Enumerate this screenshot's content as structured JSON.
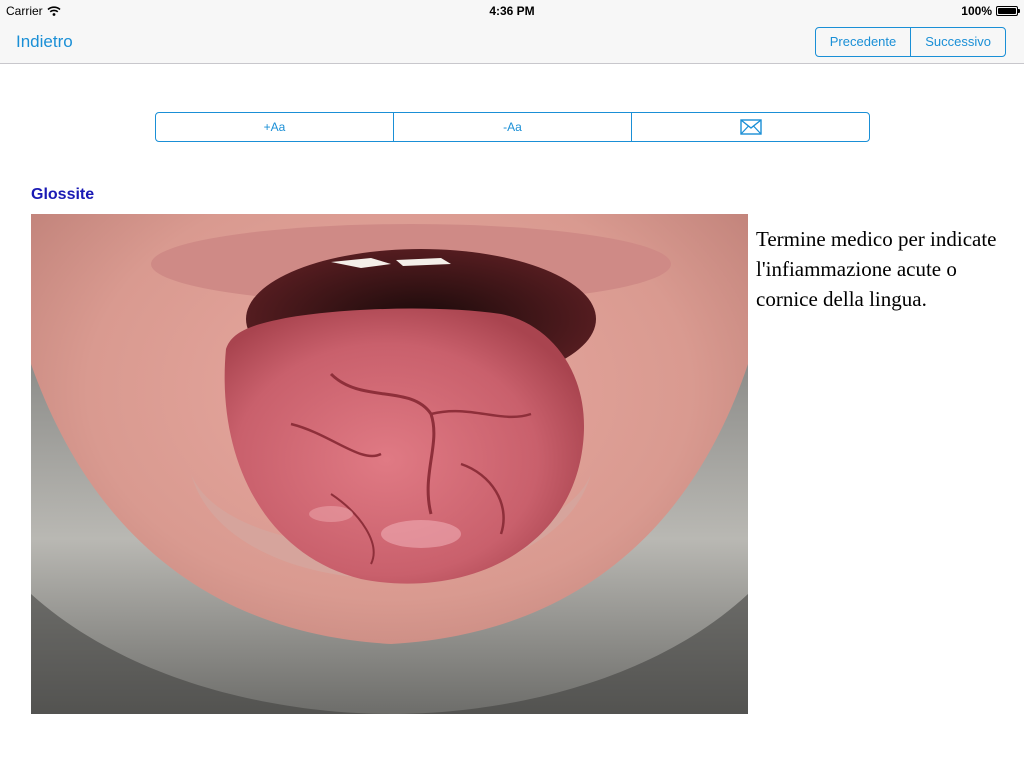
{
  "status_bar": {
    "carrier": "Carrier",
    "time": "4:36 PM",
    "battery_percent": "100%",
    "battery_level": 1.0
  },
  "nav": {
    "back_label": "Indietro",
    "prev_label": "Precedente",
    "next_label": "Successivo"
  },
  "toolbar": {
    "increase_font_label": "+Aa",
    "decrease_font_label": "-Aa",
    "email_icon": "envelope-icon"
  },
  "article": {
    "title": "Glossite",
    "description": "Termine medico per indicate l'infiammazione acute o cornice della lingua."
  },
  "colors": {
    "accent": "#1a8fd6",
    "title": "#1a1ab4"
  }
}
